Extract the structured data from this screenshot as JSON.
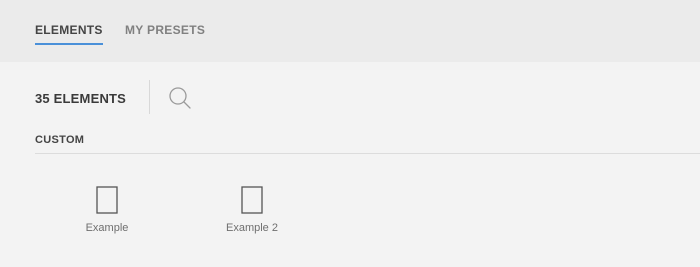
{
  "tabs": [
    {
      "label": "ELEMENTS",
      "active": true
    },
    {
      "label": "MY PRESETS",
      "active": false
    }
  ],
  "toolbar": {
    "count_label": "35 ELEMENTS",
    "search_icon": "search-icon"
  },
  "section": {
    "title": "CUSTOM"
  },
  "elements": [
    {
      "label": "Example",
      "icon": "element-icon"
    },
    {
      "label": "Example 2",
      "icon": "element-icon"
    }
  ],
  "colors": {
    "accent": "#4a90d9",
    "tabs_background": "#ebebeb",
    "panel_background": "#f3f3f3"
  }
}
